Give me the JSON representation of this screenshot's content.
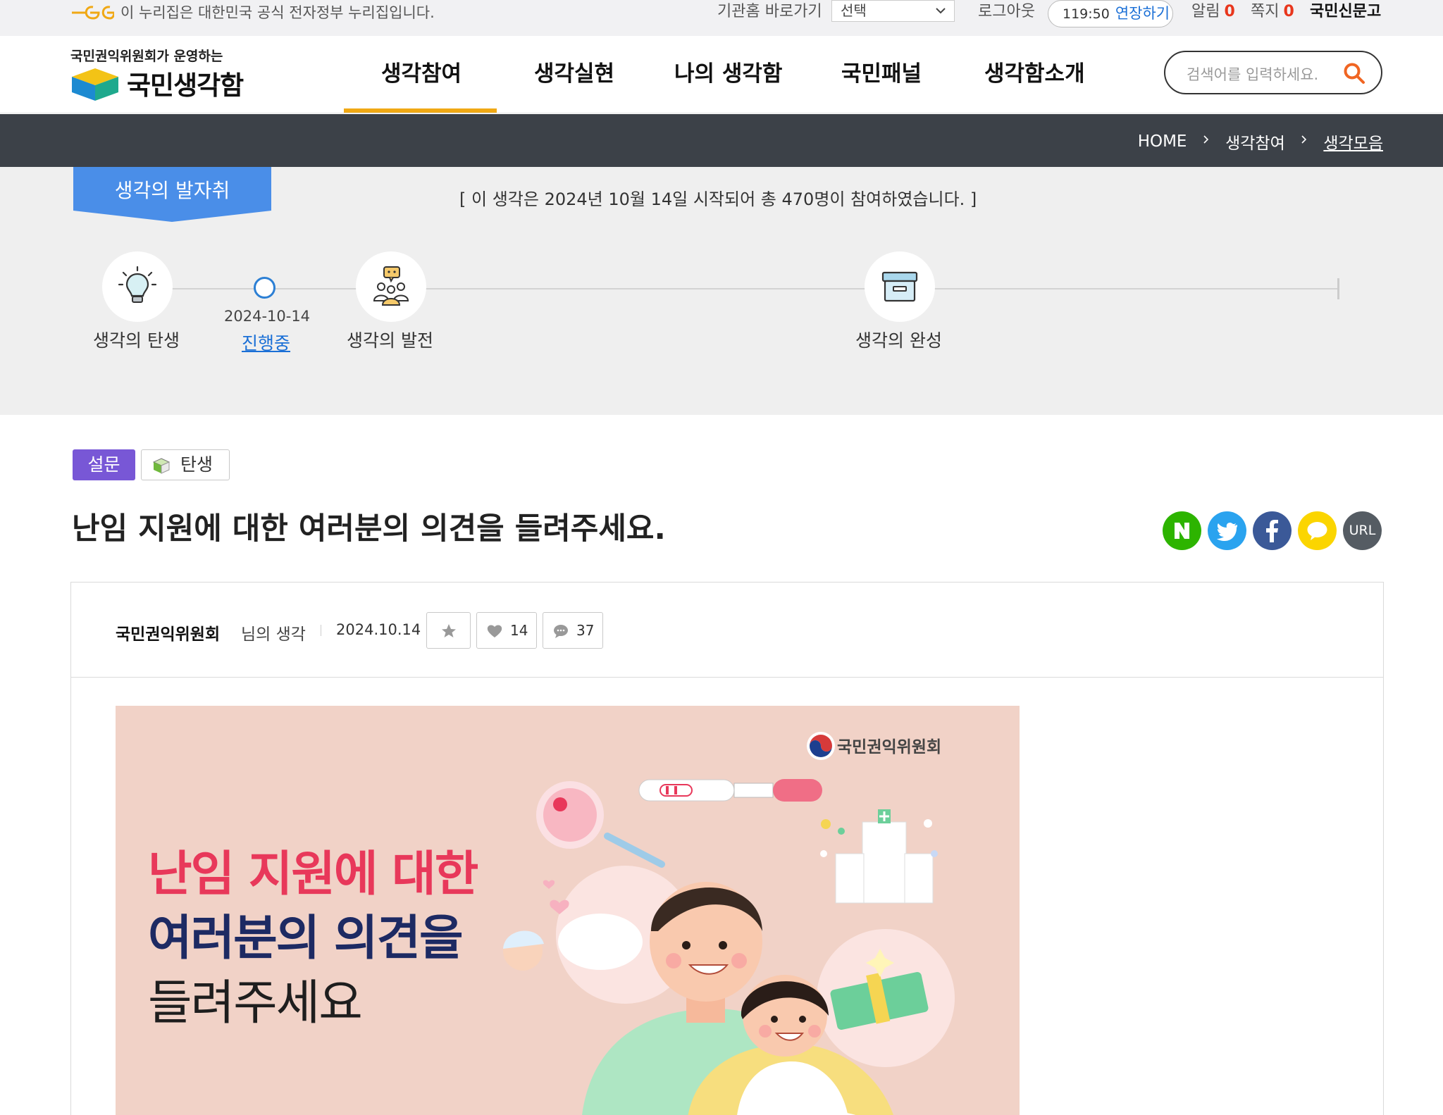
{
  "topbar": {
    "gov_notice": "이 누리집은 대한민국 공식 전자정부 누리집입니다.",
    "shortcut_label": "기관홈 바로가기",
    "shortcut_select": "선택",
    "logout": "로그아웃",
    "timer": "119:50",
    "extend": "연장하기",
    "alarm_label": "알림",
    "alarm_count": "0",
    "note_label": "쪽지",
    "note_count": "0",
    "report": "국민신문고"
  },
  "header": {
    "logo_sub": "국민권익위원회가 운영하는",
    "logo_main": "국민생각함",
    "nav": [
      "생각참여",
      "생각실현",
      "나의 생각함",
      "국민패널",
      "생각함소개"
    ],
    "search_placeholder": "검색어를 입력하세요."
  },
  "breadcrumb": {
    "home": "HOME",
    "level1": "생각참여",
    "current": "생각모음"
  },
  "timeline": {
    "ribbon": "생각의 발자취",
    "participation": "[ 이 생각은 2024년 10월 14일 시작되어 총 470명이 참여하였습니다. ]",
    "stage_birth": "생각의 탄생",
    "stage_date": "2024-10-14",
    "stage_status": "진행중",
    "stage_develop": "생각의 발전",
    "stage_complete": "생각의 완성"
  },
  "post": {
    "tag_type": "설문",
    "tag_stage": "탄생",
    "title": "난임 지원에 대한 여러분의 의견을 들려주세요.",
    "author": "국민권익위원회",
    "author_suffix": "님의 생각",
    "date": "2024.10.14",
    "likes": "14",
    "comments": "37"
  },
  "share": {
    "url_label": "URL"
  },
  "banner": {
    "org": "국민권익위원회",
    "line1": "난임 지원에 대한",
    "line2": "여러분의 의견을",
    "line3": "들려주세요"
  },
  "colors": {
    "accent_nav": "#f0a814",
    "ribbon_blue": "#4a8ee8",
    "crumb_bar": "#3c4148",
    "survey_tag": "#7857d6",
    "link_blue": "#1a6fd6"
  }
}
